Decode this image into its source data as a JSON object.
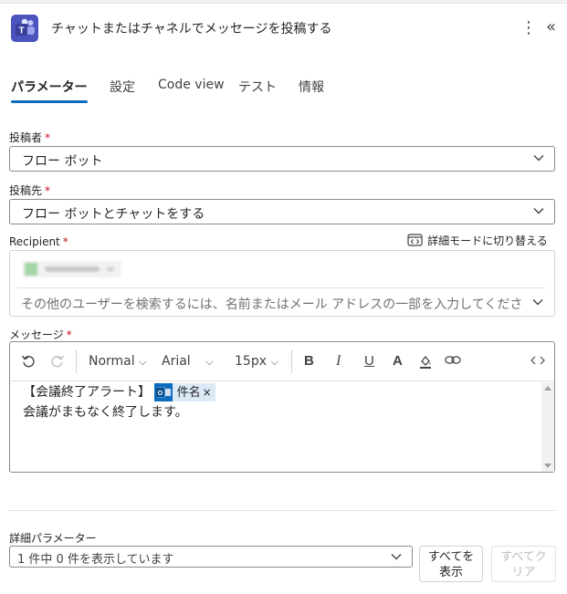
{
  "header": {
    "title": "チャットまたはチャネルでメッセージを投稿する",
    "more_icon": "more-vertical-icon",
    "collapse_icon": "double-chevron-left-icon"
  },
  "tabs": [
    {
      "label": "パラメーター",
      "active": true
    },
    {
      "label": "設定"
    },
    {
      "label": "Code view"
    },
    {
      "label": "テスト"
    },
    {
      "label": "情報"
    }
  ],
  "fields": {
    "post_as": {
      "label": "投稿者",
      "required": "*",
      "value": "フロー ボット"
    },
    "post_in": {
      "label": "投稿先",
      "required": "*",
      "value": "フロー ボットとチャットをする"
    },
    "recipient": {
      "label": "Recipient",
      "required": "*",
      "advanced_mode": "詳細モードに切り替える",
      "search_placeholder": "その他のユーザーを検索するには、名前またはメール アドレスの一部を入力してくださ"
    },
    "message": {
      "label": "メッセージ",
      "required": "*",
      "toolbar": {
        "style": "Normal",
        "font": "Arial",
        "size": "15px"
      },
      "line1_prefix": "【会議終了アラート】",
      "token_label": "件名",
      "token_remove": "×",
      "line2": "会議がまもなく終了します。"
    }
  },
  "advanced": {
    "label": "詳細パラメーター",
    "select_value": "1 件中 0 件を表示しています",
    "show_all_line1": "すべてを",
    "show_all_line2": "表示",
    "clear_all_line1": "すべてク",
    "clear_all_line2": "リア"
  },
  "colors": {
    "accent": "#0f6cbd",
    "teams": "#4b53bc",
    "required": "#c50f1f"
  }
}
